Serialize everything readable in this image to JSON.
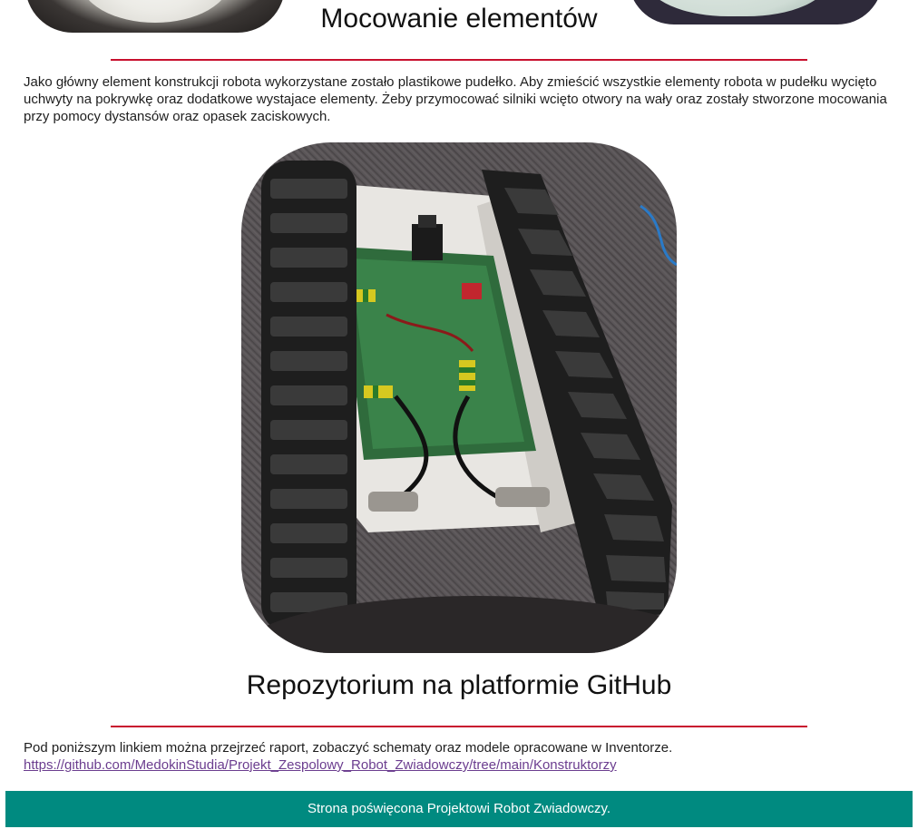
{
  "sections": {
    "mounting": {
      "title": "Mocowanie elementów",
      "text": "Jako główny element konstrukcji robota wykorzystane zostało plastikowe pudełko. Aby zmieścić wszystkie elementy robota w pudełku wycięto uchwyty na pokrywkę oraz dodatkowe wystajace elementy. Żeby przymocować silniki wcięto otwory na wały oraz zostały stworzone mocowania przy pomocy dystansów oraz opasek zaciskowych."
    },
    "repository": {
      "title": "Repozytorium na platformie GitHub",
      "text": "Pod poniższym linkiem można przejrzeć raport, zobaczyć schematy oraz modele opracowane w Inventorze.",
      "link": "https://github.com/MedokinStudia/Projekt_Zespolowy_Robot_Zwiadowczy/tree/main/Konstruktorzy"
    }
  },
  "footer": {
    "text": "Strona poświęcona Projektowi Robot Zwiadowczy."
  },
  "colors": {
    "accent_rule": "#c8102e",
    "footer_bg": "#008a80",
    "link": "#6b3d8f"
  },
  "icons": {
    "robot_photo": "tracked-robot-chassis-photo"
  }
}
